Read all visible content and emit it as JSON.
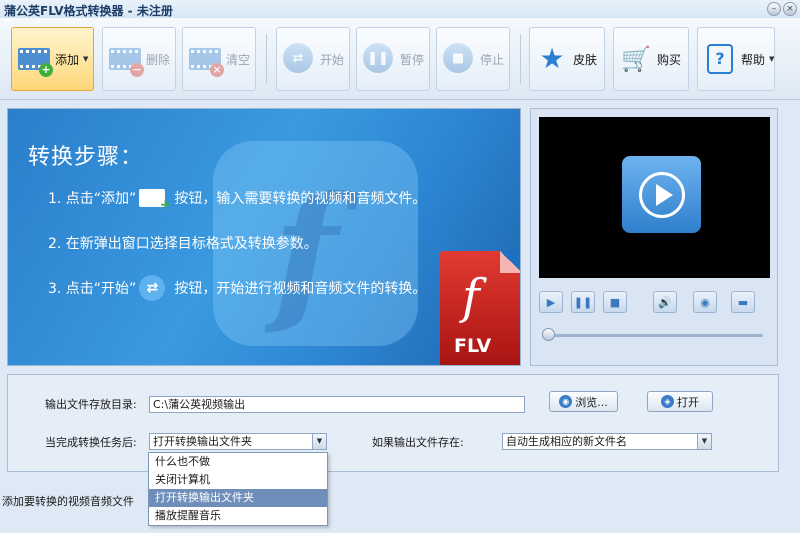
{
  "window": {
    "title": "蒲公英FLV格式转换器 - 未注册"
  },
  "toolbar": {
    "add": "添加",
    "delete": "删除",
    "clear": "清空",
    "start": "开始",
    "pause": "暂停",
    "stop": "停止",
    "skin": "皮肤",
    "buy": "购买",
    "help": "帮助"
  },
  "guide": {
    "heading": "转换步骤：",
    "step1_pre": "1. 点击“添加”",
    "step1_post": "按钮，输入需要转换的视频和音频文件。",
    "step2": "2. 在新弹出窗口选择目标格式及转换参数。",
    "step3_pre": "3. 点击“开始”",
    "step3_post": "按钮，开始进行视频和音频文件的转换。",
    "badge_text": "FLV"
  },
  "settings": {
    "output_dir_label": "输出文件存放目录:",
    "output_dir_value": "C:\\蒲公英视频输出",
    "browse": "浏览...",
    "open": "打开",
    "after_done_label": "当完成转换任务后:",
    "after_done_value": "打开转换输出文件夹",
    "exists_label": "如果输出文件存在:",
    "exists_value": "自动生成相应的新文件名"
  },
  "dropdown": {
    "options": [
      "什么也不做",
      "关闭计算机",
      "打开转换输出文件夹",
      "播放提醒音乐"
    ],
    "selected": "打开转换输出文件夹"
  },
  "status": {
    "text": "添加要转换的视频音频文件"
  },
  "colors": {
    "accent": "#2b7ecb",
    "toolbar_active": "#ffd77a"
  }
}
